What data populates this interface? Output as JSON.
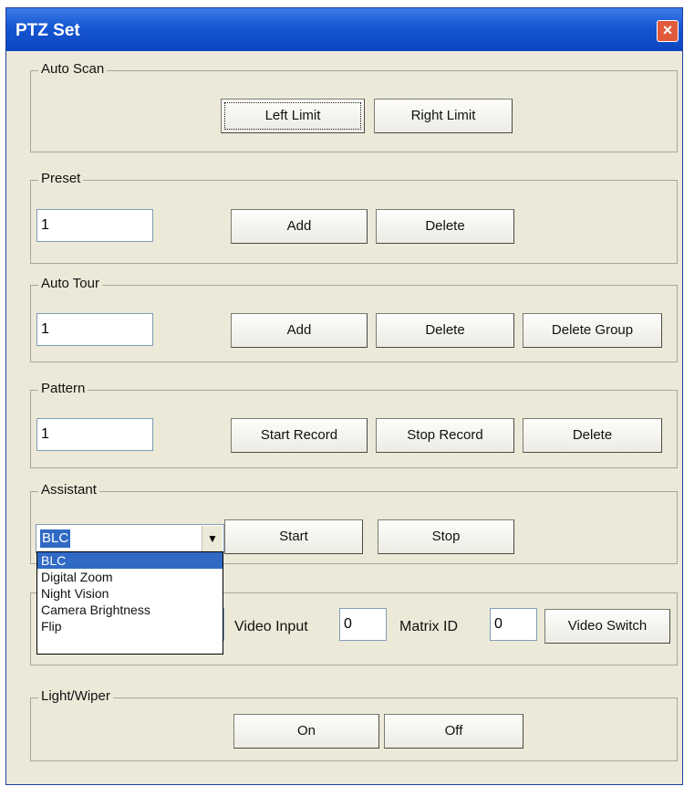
{
  "window": {
    "title": "PTZ Set",
    "close_label": "×"
  },
  "auto_scan": {
    "legend": "Auto Scan",
    "left_limit": "Left Limit",
    "right_limit": "Right Limit"
  },
  "preset": {
    "legend": "Preset",
    "value": "1",
    "add": "Add",
    "delete": "Delete"
  },
  "auto_tour": {
    "legend": "Auto Tour",
    "value": "1",
    "add": "Add",
    "delete": "Delete",
    "delete_group": "Delete Group"
  },
  "pattern": {
    "legend": "Pattern",
    "value": "1",
    "start_record": "Start Record",
    "stop_record": "Stop Record",
    "delete": "Delete"
  },
  "assistant": {
    "legend": "Assistant",
    "selected": "BLC",
    "start": "Start",
    "stop": "Stop",
    "options": [
      "BLC",
      "Digital Zoom",
      "Night Vision",
      "Camera Brightness",
      "Flip"
    ]
  },
  "matrix": {
    "video_input_label": "Video Input",
    "video_input_value": "0",
    "matrix_id_label": "Matrix ID",
    "matrix_id_value": "0",
    "video_switch": "Video Switch"
  },
  "light_wiper": {
    "legend": "Light/Wiper",
    "on": "On",
    "off": "Off"
  },
  "icons": {
    "close": "close-icon",
    "combo_arrow": "chevron-down-icon"
  }
}
